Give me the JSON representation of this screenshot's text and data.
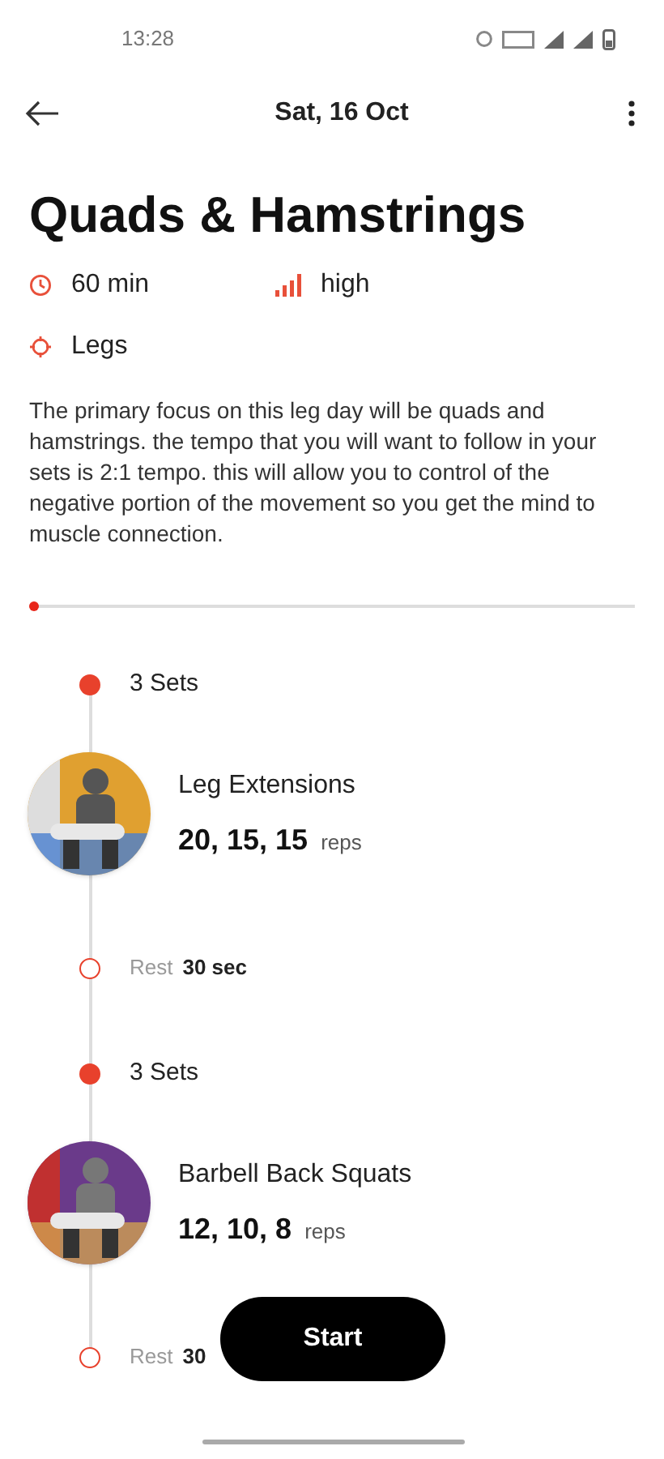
{
  "status_bar": {
    "time": "13:28"
  },
  "header": {
    "title": "Sat, 16 Oct"
  },
  "workout": {
    "title": "Quads & Hamstrings",
    "duration": "60 min",
    "intensity": "high",
    "target": "Legs",
    "description": "The primary focus on this leg day will be quads and hamstrings. the tempo that you will want to follow in your sets is 2:1 tempo. this will allow you to control of the negative portion of the movement so you get the mind to muscle connection."
  },
  "progress": {
    "level": 0.005
  },
  "timeline": [
    {
      "kind": "sets",
      "label": "3 Sets"
    },
    {
      "kind": "exercise",
      "name": "Leg Extensions",
      "reps": "20, 15, 15",
      "unit": "reps"
    },
    {
      "kind": "rest",
      "label": "Rest",
      "value": "30 sec"
    },
    {
      "kind": "sets",
      "label": "3 Sets"
    },
    {
      "kind": "exercise",
      "name": "Barbell Back Squats",
      "reps": "12, 10, 8",
      "unit": "reps"
    },
    {
      "kind": "rest",
      "label": "Rest",
      "value": "30"
    }
  ],
  "start_button": {
    "label": "Start"
  }
}
